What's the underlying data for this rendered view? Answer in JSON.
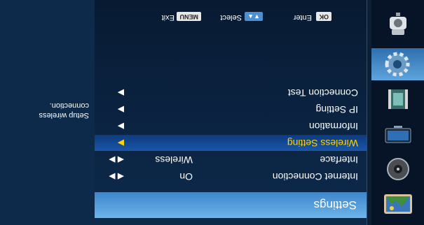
{
  "rotation_degrees": 180,
  "header": {
    "title": "Settings"
  },
  "menu": [
    {
      "label": "Internet Connection",
      "value": "On",
      "arrows": "◀ ▶"
    },
    {
      "label": "Interface",
      "value": "Wireless",
      "arrows": "◀ ▶"
    },
    {
      "label": "Wireless Setting",
      "value": "",
      "arrows": "▶"
    },
    {
      "label": "Information",
      "value": "",
      "arrows": "▶"
    },
    {
      "label": "IP Setting",
      "value": "",
      "arrows": "▶"
    },
    {
      "label": "Connection Test",
      "value": "",
      "arrows": "▶"
    }
  ],
  "selected_item": "Wireless Setting",
  "footer": {
    "ok_key": "OK",
    "enter_label": "Enter",
    "select_keys": "▼▲",
    "select_label": "Select",
    "menu_key": "MENU",
    "exit_label": "Exit"
  },
  "description": "Setup wireless connection.",
  "rail_icons": [
    "photo-icon",
    "music-disc-icon",
    "tv-icon",
    "movie-icon",
    "gear-icon",
    "camera-icon"
  ],
  "colors": {
    "highlight_text": "#ffd400",
    "header_blue": "#4f9ce0",
    "background": "#0b1f37"
  }
}
